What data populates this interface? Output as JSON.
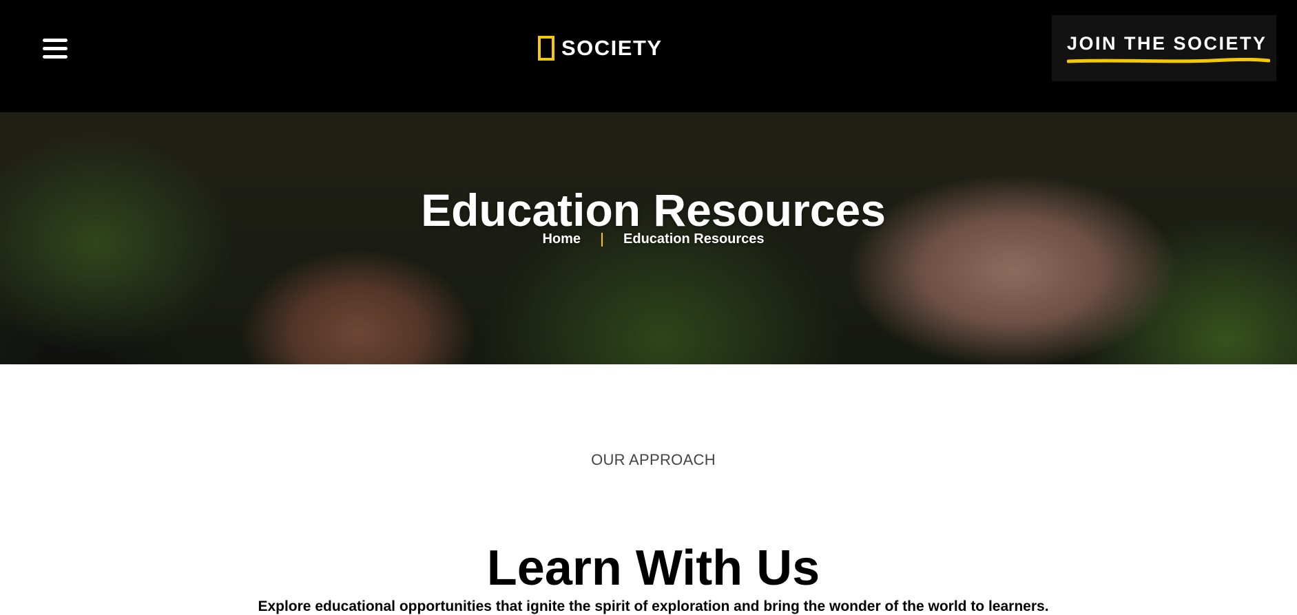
{
  "header": {
    "menu_icon": "hamburger-menu-icon",
    "logo_text": "SOCIETY",
    "brand_color": "#f6c800",
    "join_label": "JOIN THE SOCIETY"
  },
  "hero": {
    "title": "Education Resources",
    "breadcrumb": [
      {
        "label": "Home"
      },
      {
        "label": "Education Resources"
      }
    ]
  },
  "section": {
    "eyebrow": "OUR APPROACH",
    "heading": "Learn With Us",
    "description": "Explore educational opportunities that ignite the spirit of exploration and bring the wonder of the world to learners."
  }
}
